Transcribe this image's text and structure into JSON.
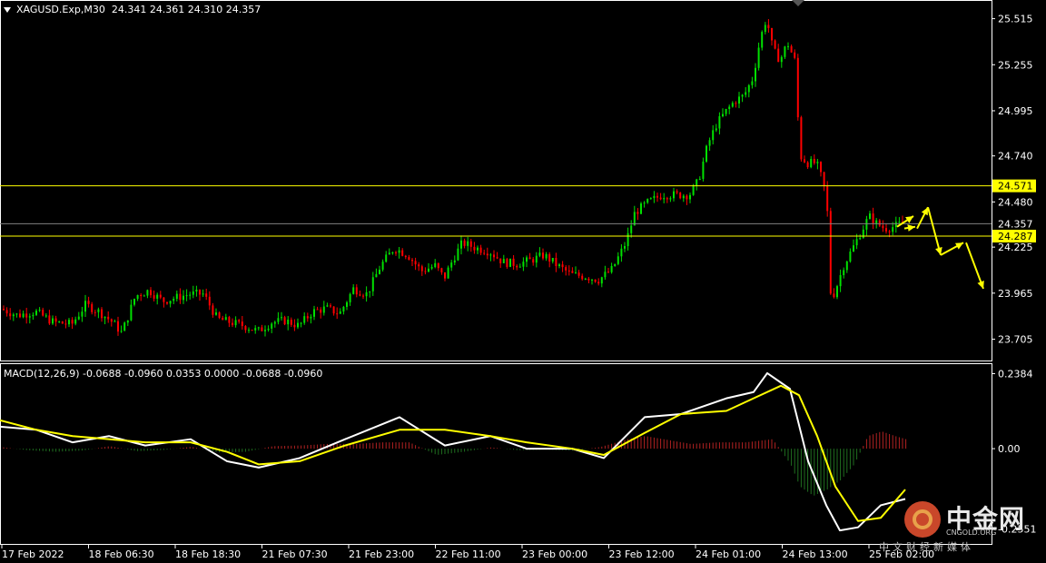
{
  "header": {
    "symbol": "XAGUSD.Exp,M30",
    "ohlc": "24.341 24.361 24.310 24.357"
  },
  "macd_header": "MACD(12,26,9) -0.0688 -0.0960 0.0353 0.0000 -0.0688 -0.0960",
  "colors": {
    "background": "#000000",
    "bull": "#00e000",
    "bear": "#ff0000",
    "level": "#ffff00",
    "price_line": "#808080",
    "macd": "#ffffff",
    "signal": "#ffff00",
    "hist_pos": "#b22222",
    "hist_neg": "#1f6f1f"
  },
  "logo": {
    "name": "中金网",
    "sub": "CNGOLD.ORG",
    "cn": "中文财经新媒体"
  },
  "chart_data": [
    {
      "type": "candlestick",
      "ylim": [
        23.6,
        25.6
      ],
      "yticks": [
        "25.515",
        "25.255",
        "24.995",
        "24.740",
        "24.480",
        "24.225",
        "23.965",
        "23.705"
      ],
      "xticks": [
        "17 Feb 2022",
        "18 Feb 06:30",
        "18 Feb 18:30",
        "21 Feb 07:30",
        "21 Feb 23:00",
        "22 Feb 11:00",
        "23 Feb 00:00",
        "23 Feb 12:00",
        "24 Feb 01:00",
        "24 Feb 13:00",
        "25 Feb 02:00"
      ],
      "levels": [
        {
          "label": "24.571",
          "value": 24.571,
          "color": "#ffff00"
        },
        {
          "label": "24.287",
          "value": 24.287,
          "color": "#ffff00"
        }
      ],
      "current_price": {
        "label": "24.357",
        "value": 24.357
      },
      "close_path": [
        [
          0,
          23.88
        ],
        [
          20,
          23.84
        ],
        [
          40,
          23.86
        ],
        [
          60,
          23.8
        ],
        [
          80,
          23.79
        ],
        [
          95,
          23.9
        ],
        [
          110,
          23.86
        ],
        [
          125,
          23.8
        ],
        [
          135,
          23.74
        ],
        [
          150,
          23.95
        ],
        [
          165,
          23.98
        ],
        [
          180,
          23.92
        ],
        [
          195,
          23.94
        ],
        [
          210,
          23.96
        ],
        [
          225,
          23.96
        ],
        [
          240,
          23.82
        ],
        [
          255,
          23.8
        ],
        [
          270,
          23.78
        ],
        [
          285,
          23.75
        ],
        [
          300,
          23.8
        ],
        [
          315,
          23.81
        ],
        [
          330,
          23.78
        ],
        [
          345,
          23.86
        ],
        [
          360,
          23.88
        ],
        [
          375,
          23.85
        ],
        [
          390,
          23.99
        ],
        [
          405,
          23.96
        ],
        [
          420,
          24.12
        ],
        [
          435,
          24.22
        ],
        [
          450,
          24.18
        ],
        [
          465,
          24.09
        ],
        [
          480,
          24.12
        ],
        [
          490,
          24.05
        ],
        [
          500,
          24.16
        ],
        [
          510,
          24.25
        ],
        [
          525,
          24.22
        ],
        [
          540,
          24.2
        ],
        [
          555,
          24.14
        ],
        [
          570,
          24.13
        ],
        [
          585,
          24.15
        ],
        [
          600,
          24.18
        ],
        [
          615,
          24.12
        ],
        [
          630,
          24.07
        ],
        [
          645,
          24.06
        ],
        [
          660,
          24.04
        ],
        [
          675,
          24.1
        ],
        [
          690,
          24.25
        ],
        [
          700,
          24.42
        ],
        [
          715,
          24.48
        ],
        [
          730,
          24.52
        ],
        [
          745,
          24.52
        ],
        [
          760,
          24.52
        ],
        [
          770,
          24.6
        ],
        [
          780,
          24.8
        ],
        [
          790,
          24.92
        ],
        [
          800,
          24.99
        ],
        [
          810,
          25.05
        ],
        [
          820,
          25.08
        ],
        [
          830,
          25.18
        ],
        [
          838,
          25.4
        ],
        [
          845,
          25.52
        ],
        [
          852,
          25.34
        ],
        [
          860,
          25.28
        ],
        [
          868,
          25.38
        ],
        [
          876,
          25.28
        ],
        [
          882,
          24.74
        ],
        [
          890,
          24.7
        ],
        [
          900,
          24.7
        ],
        [
          908,
          24.58
        ],
        [
          912,
          24.42
        ],
        [
          916,
          23.92
        ],
        [
          922,
          24.0
        ],
        [
          930,
          24.12
        ],
        [
          940,
          24.22
        ],
        [
          950,
          24.32
        ],
        [
          958,
          24.4
        ],
        [
          966,
          24.36
        ],
        [
          975,
          24.33
        ],
        [
          985,
          24.34
        ],
        [
          995,
          24.36
        ]
      ],
      "forecast_arrows": [
        [
          [
            988,
            24.34
          ],
          [
            1006,
            24.4
          ]
        ],
        [
          [
            996,
            24.33
          ],
          [
            1008,
            24.34
          ]
        ],
        [
          [
            1010,
            24.33
          ],
          [
            1022,
            24.45
          ]
        ],
        [
          [
            1022,
            24.45
          ],
          [
            1036,
            24.18
          ]
        ],
        [
          [
            1036,
            24.18
          ],
          [
            1061,
            24.25
          ]
        ],
        [
          [
            1064,
            24.25
          ],
          [
            1083,
            23.99
          ]
        ]
      ]
    },
    {
      "type": "line",
      "title": "MACD(12,26,9)",
      "ylim": [
        -0.3,
        0.26
      ],
      "yticks": [
        "0.2384",
        "0.00",
        "-0.2551"
      ],
      "series": [
        {
          "color": "#ffffff",
          "points": [
            [
              0,
              0.07
            ],
            [
              40,
              0.06
            ],
            [
              80,
              0.02
            ],
            [
              120,
              0.04
            ],
            [
              160,
              0.01
            ],
            [
              210,
              0.03
            ],
            [
              250,
              -0.04
            ],
            [
              285,
              -0.06
            ],
            [
              330,
              -0.03
            ],
            [
              380,
              0.03
            ],
            [
              440,
              0.1
            ],
            [
              490,
              0.01
            ],
            [
              540,
              0.04
            ],
            [
              580,
              0.0
            ],
            [
              630,
              0.0
            ],
            [
              665,
              -0.03
            ],
            [
              710,
              0.1
            ],
            [
              750,
              0.11
            ],
            [
              800,
              0.16
            ],
            [
              830,
              0.18
            ],
            [
              845,
              0.24
            ],
            [
              870,
              0.19
            ],
            [
              890,
              -0.04
            ],
            [
              910,
              -0.18
            ],
            [
              925,
              -0.26
            ],
            [
              945,
              -0.25
            ],
            [
              970,
              -0.18
            ],
            [
              997,
              -0.16
            ]
          ]
        },
        {
          "color": "#ffff00",
          "points": [
            [
              0,
              0.09
            ],
            [
              40,
              0.06
            ],
            [
              80,
              0.04
            ],
            [
              120,
              0.03
            ],
            [
              160,
              0.02
            ],
            [
              210,
              0.02
            ],
            [
              250,
              -0.01
            ],
            [
              285,
              -0.05
            ],
            [
              330,
              -0.04
            ],
            [
              380,
              0.01
            ],
            [
              440,
              0.06
            ],
            [
              490,
              0.06
            ],
            [
              540,
              0.04
            ],
            [
              580,
              0.02
            ],
            [
              630,
              0.0
            ],
            [
              665,
              -0.02
            ],
            [
              710,
              0.05
            ],
            [
              750,
              0.11
            ],
            [
              800,
              0.12
            ],
            [
              830,
              0.16
            ],
            [
              860,
              0.2
            ],
            [
              880,
              0.17
            ],
            [
              900,
              0.04
            ],
            [
              920,
              -0.12
            ],
            [
              945,
              -0.23
            ],
            [
              970,
              -0.22
            ],
            [
              997,
              -0.13
            ]
          ]
        }
      ],
      "histogram": [
        [
          0,
          0.005
        ],
        [
          30,
          -0.005
        ],
        [
          60,
          -0.01
        ],
        [
          90,
          -0.006
        ],
        [
          120,
          0.008
        ],
        [
          150,
          -0.008
        ],
        [
          180,
          -0.004
        ],
        [
          210,
          0.006
        ],
        [
          240,
          -0.012
        ],
        [
          270,
          -0.01
        ],
        [
          300,
          0.008
        ],
        [
          330,
          0.01
        ],
        [
          360,
          0.015
        ],
        [
          390,
          0.015
        ],
        [
          420,
          0.02
        ],
        [
          450,
          0.02
        ],
        [
          480,
          -0.02
        ],
        [
          510,
          -0.01
        ],
        [
          540,
          0.004
        ],
        [
          570,
          -0.005
        ],
        [
          600,
          -0.003
        ],
        [
          630,
          -0.006
        ],
        [
          660,
          0.005
        ],
        [
          690,
          0.03
        ],
        [
          710,
          0.04
        ],
        [
          730,
          0.03
        ],
        [
          760,
          0.015
        ],
        [
          790,
          0.02
        ],
        [
          820,
          0.02
        ],
        [
          850,
          0.03
        ],
        [
          870,
          -0.05
        ],
        [
          880,
          -0.12
        ],
        [
          895,
          -0.15
        ],
        [
          910,
          -0.13
        ],
        [
          925,
          -0.1
        ],
        [
          940,
          -0.05
        ],
        [
          955,
          0.04
        ],
        [
          970,
          0.055
        ],
        [
          985,
          0.04
        ],
        [
          997,
          0.03
        ]
      ]
    }
  ]
}
